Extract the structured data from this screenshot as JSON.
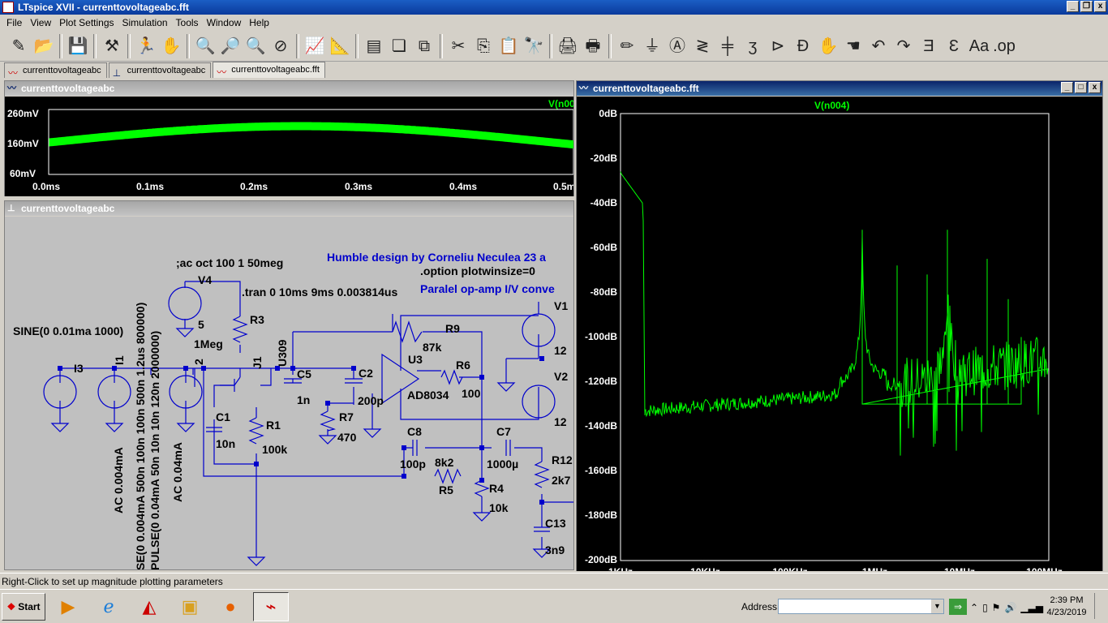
{
  "app": {
    "title": "LTspice XVII - currenttovoltageabc.fft",
    "controls": {
      "minimize": "_",
      "restore": "❐",
      "close": "x"
    }
  },
  "menu": [
    "File",
    "View",
    "Plot Settings",
    "Simulation",
    "Tools",
    "Window",
    "Help"
  ],
  "tabs": [
    {
      "label": "currenttovoltageabc",
      "icon": "waveform-icon"
    },
    {
      "label": "currenttovoltageabc",
      "icon": "schematic-icon"
    },
    {
      "label": "currenttovoltageabc.fft",
      "icon": "waveform-icon"
    }
  ],
  "time_plot": {
    "window_title": "currenttovoltageabc",
    "trace_label": "V(n00",
    "y_ticks": [
      "260mV",
      "160mV",
      "60mV"
    ],
    "x_ticks": [
      "0.0ms",
      "0.1ms",
      "0.2ms",
      "0.3ms",
      "0.4ms",
      "0.5m"
    ],
    "trace_color": "#00ff00"
  },
  "schematic": {
    "window_title": "currenttovoltageabc",
    "directives": {
      "title_text": "Humble design by Corneliu Neculea 23 a",
      "option": ".option plotwinsize=0",
      "subtitle": "Paralel op-amp I/V conve",
      "ac": ";ac oct 100 1 50meg",
      "tran": ".tran 0 10ms 9ms 0.003814us",
      "sine": "SINE(0 0.01ma 1000)",
      "i1_pwl": "SE(0 0.004mA 500n 100n 100n 500n 1.2us 800000)",
      "i2_pulse": "PULSE(0 0.04mA 50n 10n 10n 120n 2000000)",
      "i1_ac": "AC 0.004mA",
      "i2_ac": "AC 0.04mA"
    },
    "labels": {
      "V4": "V4",
      "V4val": "5",
      "R3": "R3",
      "R3val": "1Meg",
      "J1": "J1",
      "U309": "U309",
      "I3": "I3",
      "I1": "I1",
      "N2": "2",
      "C5": "C5",
      "C5val": "1n",
      "C2": "C2",
      "C2val": "200p",
      "R7": "R7",
      "R7val": "470",
      "C1": "C1",
      "C1val": "10n",
      "R1": "R1",
      "R1val": "100k",
      "R9": "R9",
      "R9val": "87k",
      "U3": "U3",
      "U3val": "AD8034",
      "R6": "R6",
      "R6val": "100",
      "V1": "V1",
      "V1val": "12",
      "V2": "V2",
      "V2val": "12",
      "C8": "C8",
      "C8val": "100p",
      "R5": "R5",
      "R5val": "8k2",
      "C7": "C7",
      "C7val": "1000µ",
      "R4": "R4",
      "R4val": "10k",
      "R12": "R12",
      "R12val": "2k7",
      "C13": "C13",
      "C13val": "3n9"
    }
  },
  "fft_plot": {
    "window_title": "currenttovoltageabc.fft",
    "trace_label": "V(n004)",
    "y_ticks": [
      "0dB",
      "-20dB",
      "-40dB",
      "-60dB",
      "-80dB",
      "-100dB",
      "-120dB",
      "-140dB",
      "-160dB",
      "-180dB",
      "-200dB"
    ],
    "x_ticks": [
      "1KHz",
      "10KHz",
      "100KHz",
      "1MHz",
      "10MHz",
      "100MHz"
    ],
    "trace_color": "#00ff00"
  },
  "status": "Right-Click to set up magnitude plotting parameters",
  "taskbar": {
    "start": "Start",
    "address_label": "Address",
    "address_value": "",
    "time": "2:39 PM",
    "date": "4/23/2019"
  }
}
